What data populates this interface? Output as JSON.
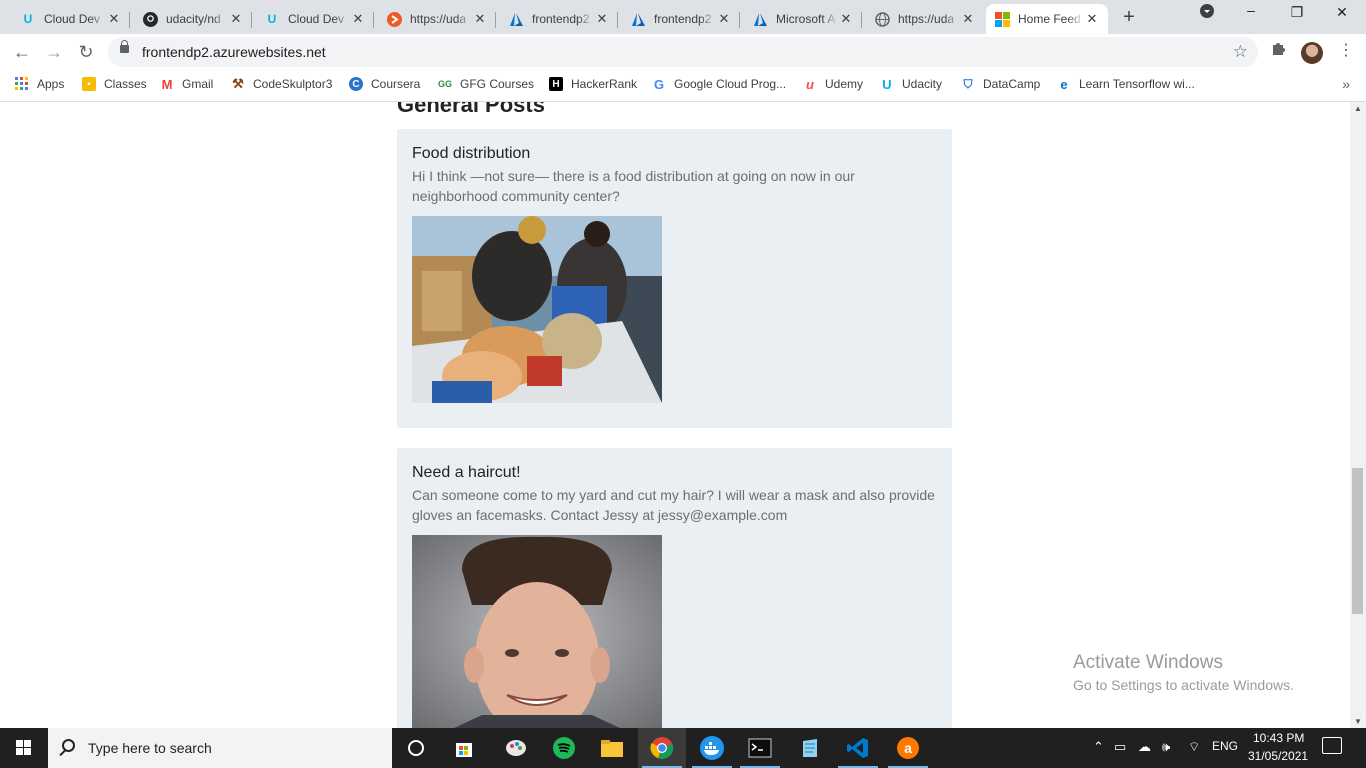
{
  "browser": {
    "tabs": [
      {
        "title": "Cloud Dev",
        "icon": "udacity-icon",
        "color": "#02b3e4"
      },
      {
        "title": "udacity/nd",
        "icon": "github-icon",
        "color": "#24292e"
      },
      {
        "title": "Cloud Dev",
        "icon": "udacity-icon",
        "color": "#02b3e4"
      },
      {
        "title": "https://uda",
        "icon": "orange-circle-icon",
        "color": "#ee5a24"
      },
      {
        "title": "frontendp2",
        "icon": "azure-icon",
        "color": "#0078d4"
      },
      {
        "title": "frontendp2",
        "icon": "azure-icon",
        "color": "#0078d4"
      },
      {
        "title": "Microsoft A",
        "icon": "azure-icon",
        "color": "#0078d4"
      },
      {
        "title": "https://uda",
        "icon": "globe-icon",
        "color": "#5f6368"
      },
      {
        "title": "Home Feed",
        "icon": "microsoft-icon",
        "color": "#f25022",
        "active": true
      }
    ],
    "close_glyph": "✕",
    "new_tab_glyph": "+",
    "url": "frontendp2.azurewebsites.net"
  },
  "bookmarks": [
    {
      "label": "Apps",
      "icon": "apps-grid-icon",
      "color": "#4285f4"
    },
    {
      "label": "Classes",
      "icon": "google-classroom-icon",
      "color": "#f9bb00"
    },
    {
      "label": "Gmail",
      "icon": "gmail-icon",
      "color": "#ea4335"
    },
    {
      "label": "CodeSkulptor3",
      "icon": "hammer-icon",
      "color": "#8b4513"
    },
    {
      "label": "Coursera",
      "icon": "coursera-icon",
      "color": "#2a73cc"
    },
    {
      "label": "GFG Courses",
      "icon": "gfg-icon",
      "color": "#2f8d46"
    },
    {
      "label": "HackerRank",
      "icon": "hackerrank-icon",
      "color": "#000000"
    },
    {
      "label": "Google Cloud Prog...",
      "icon": "google-icon",
      "color": "#4285f4"
    },
    {
      "label": "Udemy",
      "icon": "udemy-icon",
      "color": "#ec5252"
    },
    {
      "label": "Udacity",
      "icon": "udacity-icon",
      "color": "#02b3e4"
    },
    {
      "label": "DataCamp",
      "icon": "datacamp-icon",
      "color": "#03ef62"
    },
    {
      "label": "Learn Tensorflow wi...",
      "icon": "edge-icon",
      "color": "#0078d4"
    }
  ],
  "page": {
    "section_title": "General Posts",
    "posts": [
      {
        "title": "Food distribution",
        "body": "Hi I think —not sure— there is a food distribution at going on now in our neighborhood community center?",
        "image": "food-distribution-photo"
      },
      {
        "title": "Need a haircut!",
        "body": "Can someone come to my yard and cut my hair? I will wear a mask and also provide gloves an facemasks. Contact Jessy at jessy@example.com",
        "image": "haircut-photo"
      }
    ]
  },
  "watermark": {
    "line1": "Activate Windows",
    "line2": "Go to Settings to activate Windows."
  },
  "taskbar": {
    "search_placeholder": "Type here to search",
    "language": "ENG",
    "time": "10:43 PM",
    "date": "31/05/2021"
  }
}
